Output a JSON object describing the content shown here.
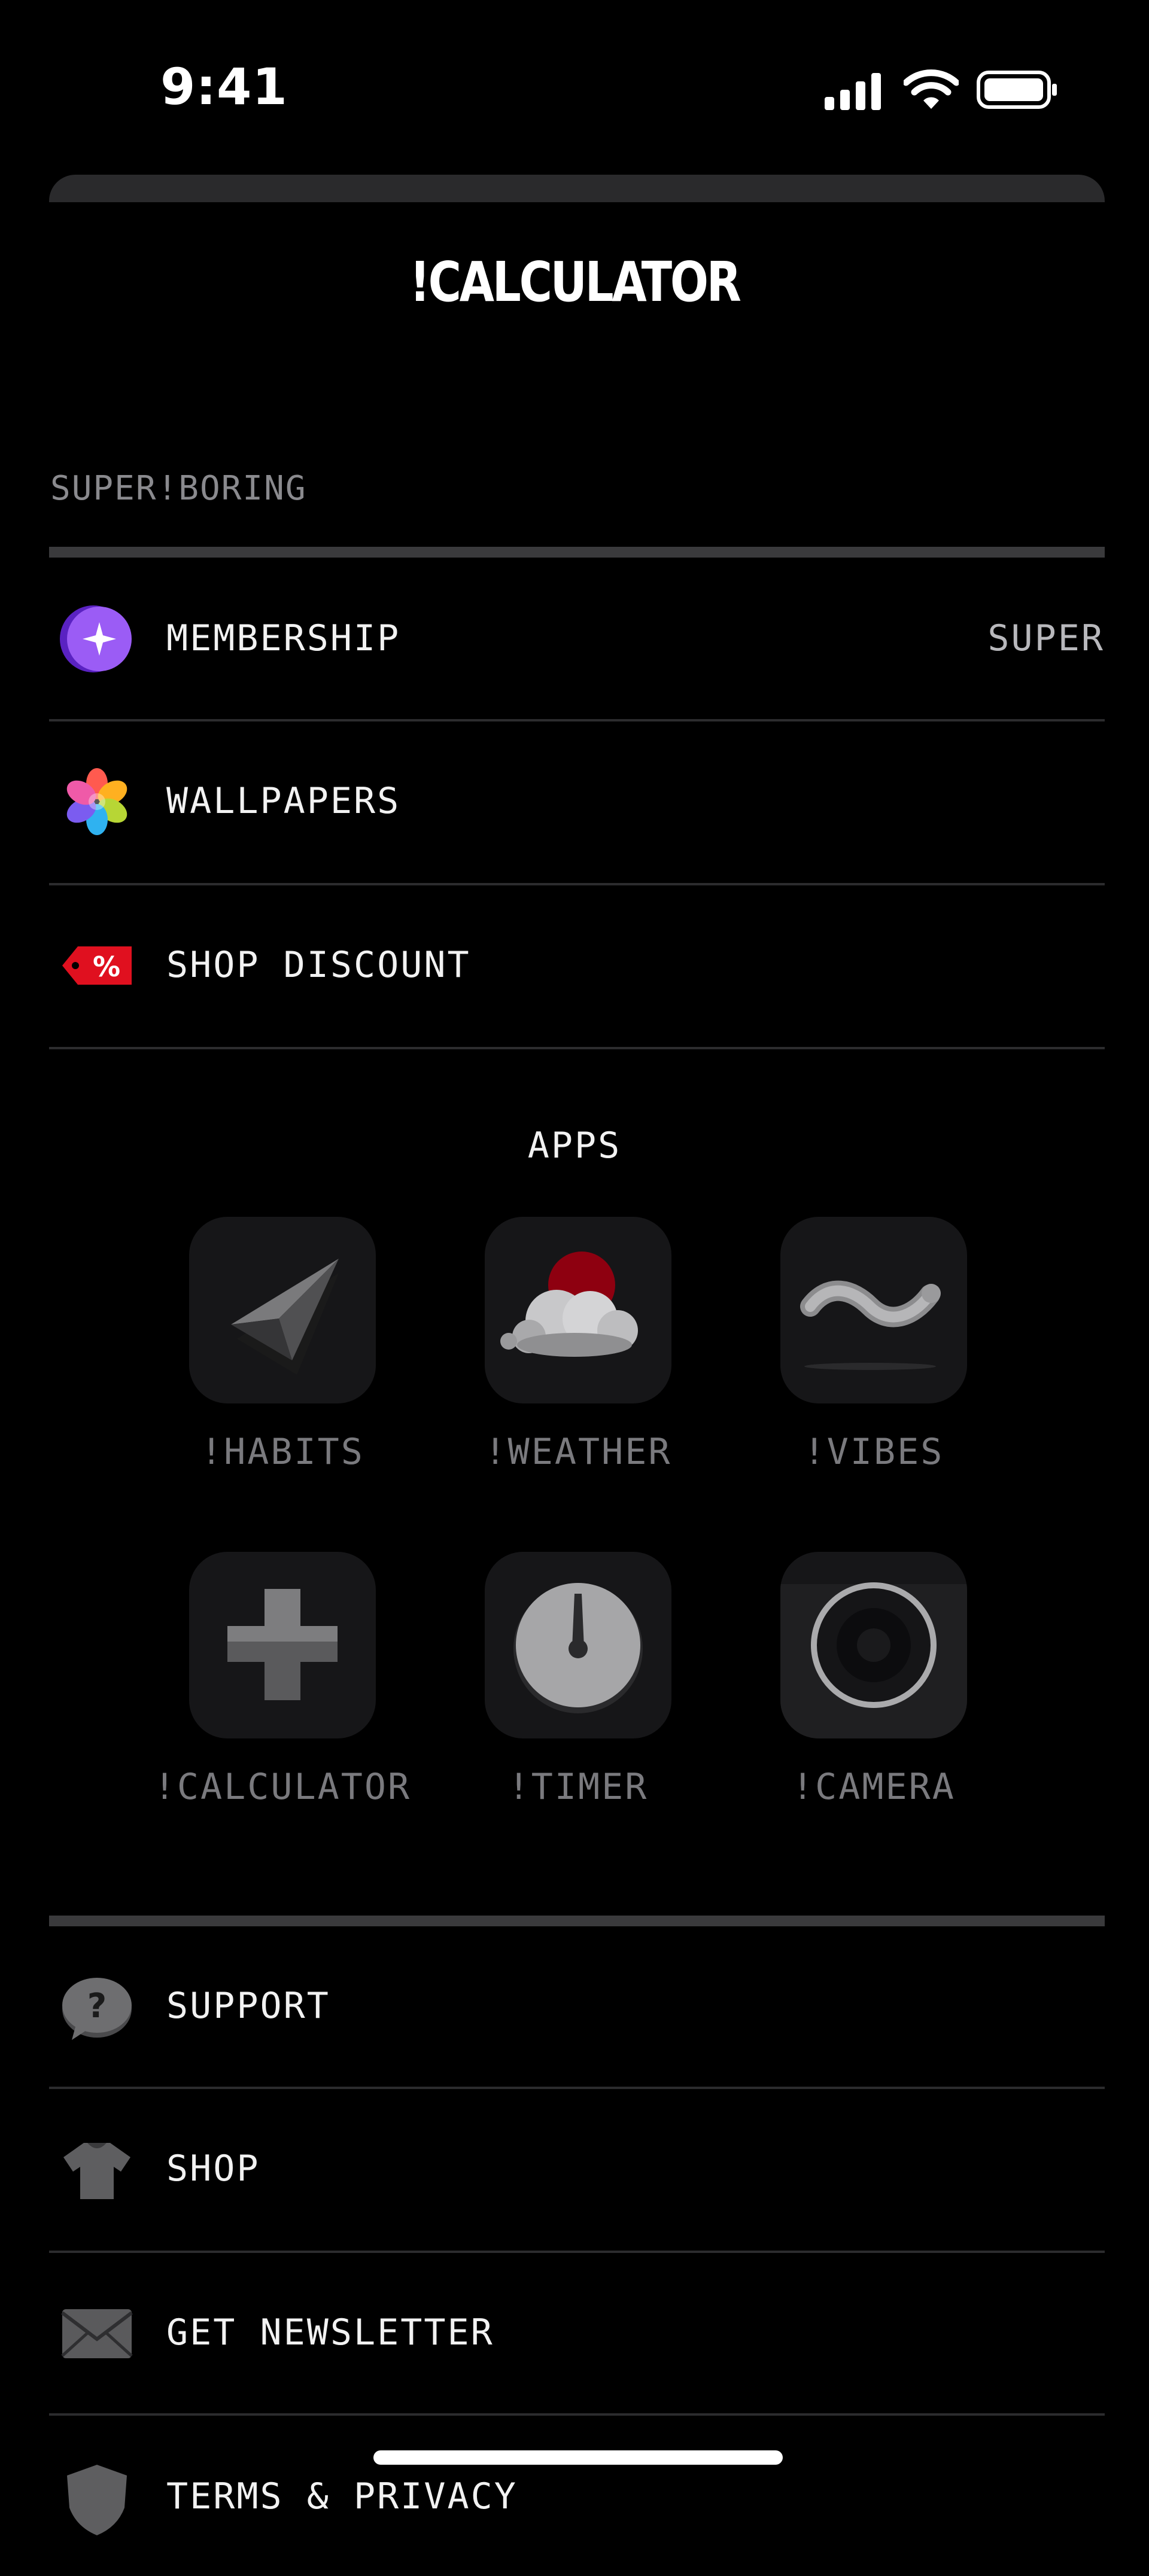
{
  "status_bar": {
    "time": "9:41"
  },
  "sheet": {
    "title": "!CALCULATOR"
  },
  "sections": {
    "brand": "SUPER!BORING",
    "apps_title": "APPS"
  },
  "top_rows": [
    {
      "label": "MEMBERSHIP",
      "value": "SUPER",
      "icon": "membership-star-icon"
    },
    {
      "label": "WALLPAPERS",
      "icon": "wallpapers-flower-icon"
    },
    {
      "label": "SHOP DISCOUNT",
      "icon": "discount-tag-icon"
    }
  ],
  "apps": [
    {
      "label": "!HABITS",
      "icon": "habits-arrow-icon"
    },
    {
      "label": "!WEATHER",
      "icon": "weather-cloud-icon"
    },
    {
      "label": "!VIBES",
      "icon": "vibes-wave-icon"
    },
    {
      "label": "!CALCULATOR",
      "icon": "calculator-plus-icon"
    },
    {
      "label": "!TIMER",
      "icon": "timer-dial-icon"
    },
    {
      "label": "!CAMERA",
      "icon": "camera-lens-icon"
    }
  ],
  "bottom_rows": [
    {
      "label": "SUPPORT",
      "icon": "support-question-icon"
    },
    {
      "label": "SHOP",
      "icon": "shop-tshirt-icon"
    },
    {
      "label": "GET NEWSLETTER",
      "icon": "newsletter-envelope-icon"
    },
    {
      "label": "TERMS & PRIVACY",
      "icon": "shield-icon"
    }
  ],
  "colors": {
    "background": "#000000",
    "sheet_handle": "#2a2a2c",
    "divider": "#2c2c2e",
    "membership_purple": "#7b3fe4",
    "discount_red": "#e0101f",
    "weather_red": "#b00010"
  }
}
